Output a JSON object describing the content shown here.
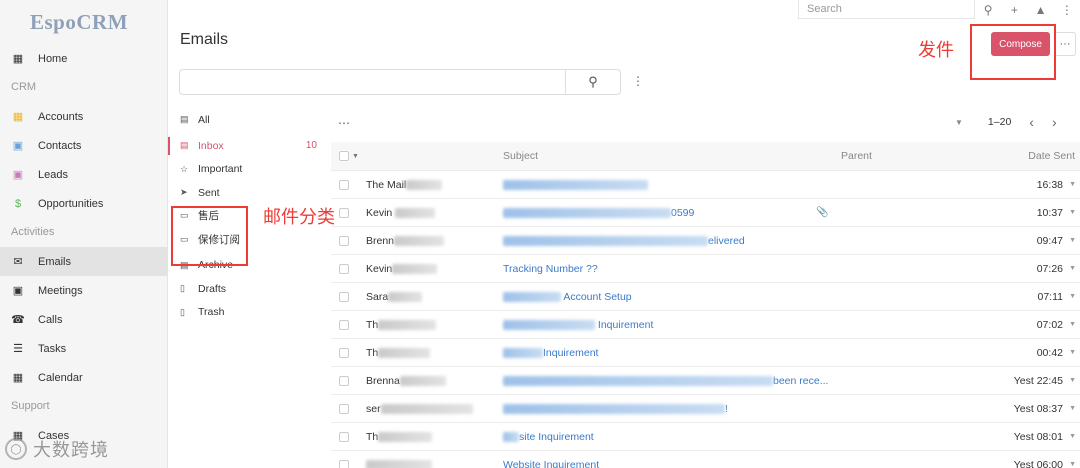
{
  "app": {
    "logo_text": "EspoCRM"
  },
  "topbar": {
    "search_placeholder": "Search"
  },
  "sidebar": {
    "home": "Home",
    "group_crm": "CRM",
    "crm_items": [
      "Accounts",
      "Contacts",
      "Leads",
      "Opportunities"
    ],
    "group_activities": "Activities",
    "activity_items": [
      "Emails",
      "Meetings",
      "Calls",
      "Tasks",
      "Calendar"
    ],
    "group_support": "Support",
    "support_items": [
      "Cases"
    ]
  },
  "header": {
    "title": "Emails",
    "compose_label": "Compose",
    "more_label": "···"
  },
  "annotations": {
    "compose_note": "发件",
    "folders_note": "邮件分类"
  },
  "folders": {
    "all": "All",
    "inbox": "Inbox",
    "inbox_count": "10",
    "important": "Important",
    "sent": "Sent",
    "custom1": "售后",
    "custom2": "保修订阅",
    "archive": "Archive",
    "drafts": "Drafts",
    "trash": "Trash"
  },
  "list": {
    "pagination_range": "1–20",
    "columns": {
      "subject": "Subject",
      "parent": "Parent",
      "date_sent": "Date Sent"
    },
    "rows": [
      {
        "from": "The Mail",
        "subject": "",
        "date": "16:38"
      },
      {
        "from": "Kevin",
        "subject": "0599",
        "date": "10:37",
        "attachment": true
      },
      {
        "from": "Brenn",
        "subject": "elivered",
        "date": "09:47"
      },
      {
        "from": "Kevin",
        "subject": "Tracking Number ??",
        "date": "07:26"
      },
      {
        "from": "Sara",
        "subject": "Account Setup",
        "date": "07:11"
      },
      {
        "from": "Th",
        "subject": "Inquirement",
        "date": "07:02"
      },
      {
        "from": "Th",
        "subject": "Inquirement",
        "date": "00:42"
      },
      {
        "from": "Brenna",
        "subject": "been rece...",
        "date": "Yest 22:45"
      },
      {
        "from": "ser",
        "subject": "!",
        "date": "Yest 08:37"
      },
      {
        "from": "Th",
        "subject": "site Inquirement",
        "date": "Yest 08:01"
      },
      {
        "from": "",
        "subject": "Website Inquirement",
        "date": "Yest 06:00"
      }
    ]
  },
  "watermark": {
    "text": "大数跨境"
  },
  "colors": {
    "accent": "#d9536b",
    "link": "#3a7bc8",
    "annotation": "#ee3b36"
  }
}
